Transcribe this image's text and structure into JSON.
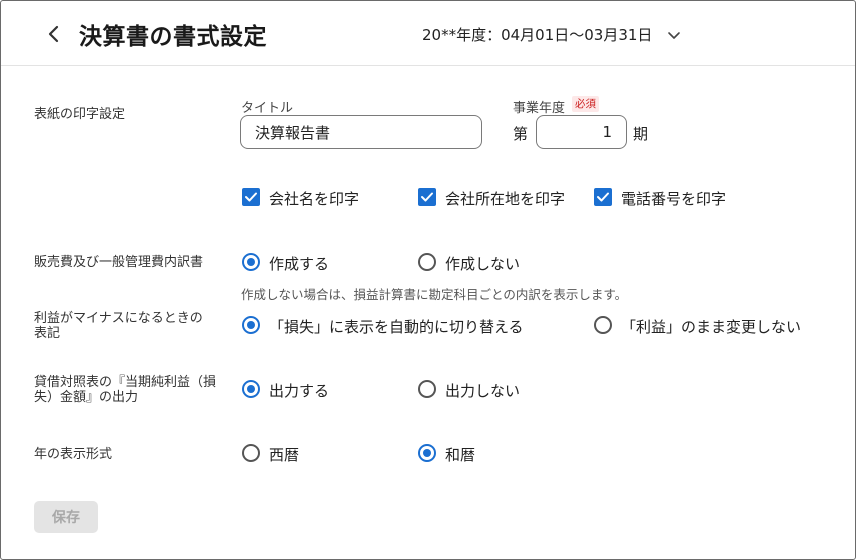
{
  "header": {
    "title": "決算書の書式設定",
    "period": "20**年度：04月01日〜03月31日"
  },
  "cover": {
    "label": "表紙の印字設定",
    "title_label": "タイトル",
    "title_value": "決算報告書",
    "fiscal_year_label": "事業年度",
    "required_badge": "必須",
    "term_prefix": "第",
    "term_value": "1",
    "term_suffix": "期",
    "checkboxes": [
      {
        "label": "会社名を印字",
        "checked": true
      },
      {
        "label": "会社所在地を印字",
        "checked": true
      },
      {
        "label": "電話番号を印字",
        "checked": true
      }
    ]
  },
  "sga": {
    "label": "販売費及び一般管理費内訳書",
    "options": [
      {
        "label": "作成する",
        "selected": true
      },
      {
        "label": "作成しない",
        "selected": false
      }
    ],
    "note": "作成しない場合は、損益計算書に勘定科目ごとの内訳を表示します。"
  },
  "negative_profit": {
    "label_line1": "利益がマイナスになるときの",
    "label_line2": "表記",
    "options": [
      {
        "label": "「損失」に表示を自動的に切り替える",
        "selected": true
      },
      {
        "label": "「利益」のまま変更しない",
        "selected": false
      }
    ]
  },
  "balance_sheet": {
    "label_line1": "貸借対照表の『当期純利益（損",
    "label_line2": "失）金額』の出力",
    "options": [
      {
        "label": "出力する",
        "selected": true
      },
      {
        "label": "出力しない",
        "selected": false
      }
    ]
  },
  "year_format": {
    "label": "年の表示形式",
    "options": [
      {
        "label": "西暦",
        "selected": false
      },
      {
        "label": "和暦",
        "selected": true
      }
    ]
  },
  "save_label": "保存",
  "colors": {
    "accent": "#1b6fd1",
    "required": "#cc2222",
    "disabled_button": "#e4e4e4"
  }
}
